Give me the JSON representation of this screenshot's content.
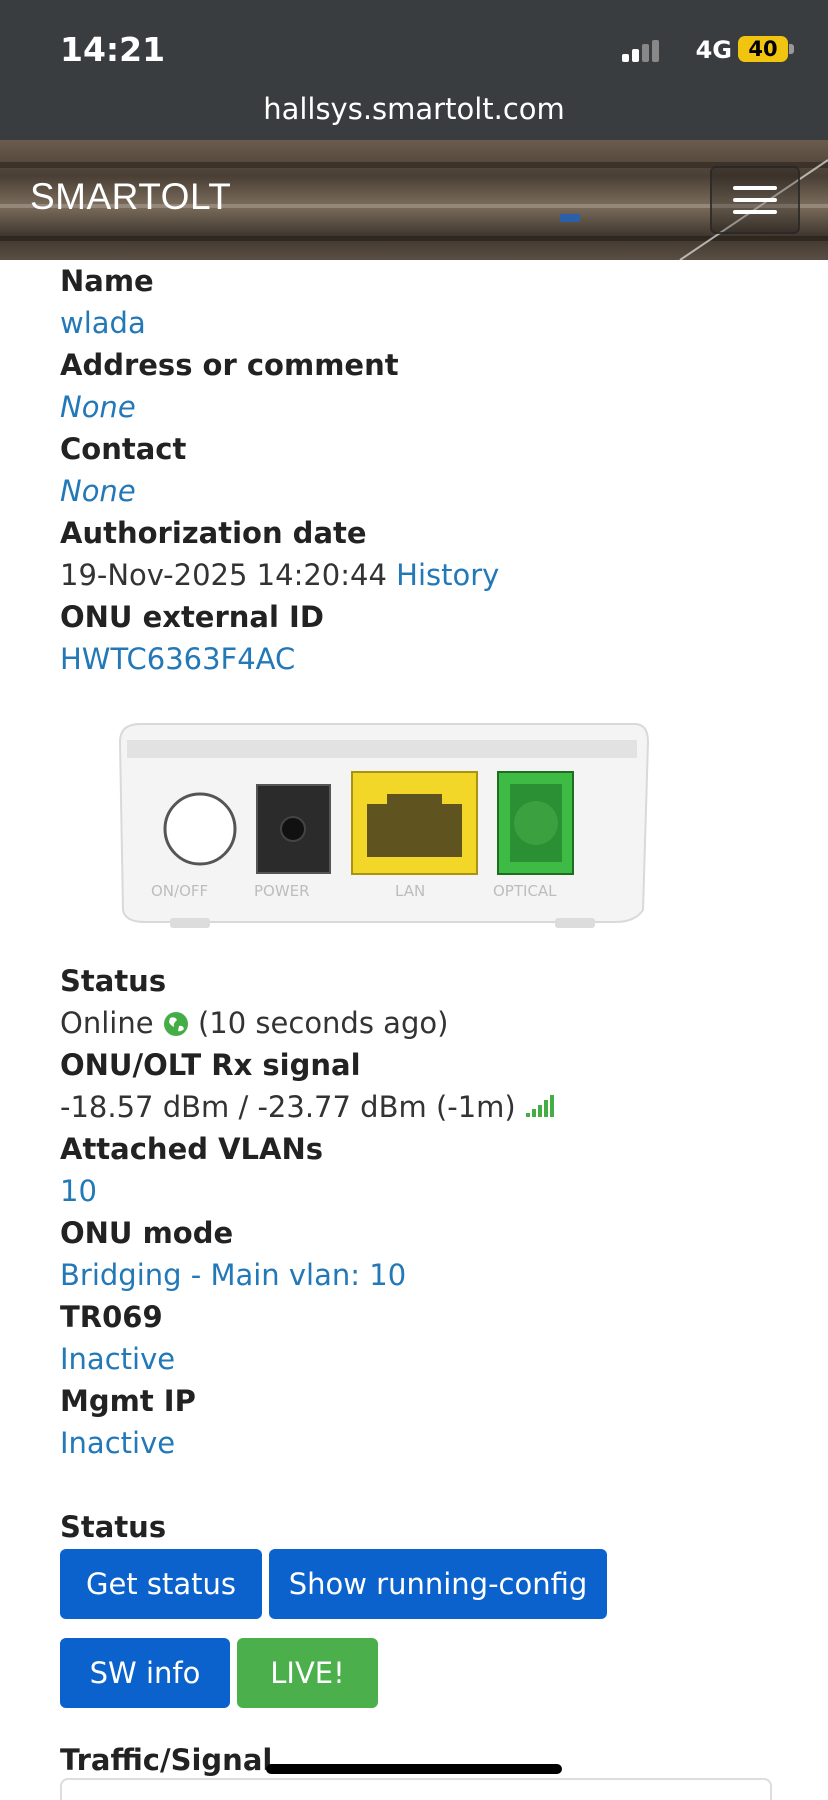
{
  "status_bar": {
    "time": "14:21",
    "network": "4G",
    "battery": "40"
  },
  "browser": {
    "url": "hallsys.smartolt.com"
  },
  "navbar": {
    "brand": "SMARTOLT"
  },
  "details": [
    {
      "label": "Name",
      "value": "wlada"
    },
    {
      "label": "Address or comment",
      "value": "None"
    },
    {
      "label": "Contact",
      "value": "None"
    },
    {
      "label": "Authorization date",
      "value": "19-Nov-2025 14:20:44",
      "link": "History"
    },
    {
      "label": "ONU external ID",
      "value": "HWTC6363F4AC"
    }
  ],
  "device_image": {
    "ports": [
      "ON/OFF",
      "POWER",
      "LAN",
      "OPTICAL"
    ]
  },
  "status_info": [
    {
      "label": "Status",
      "value": "Online",
      "extra": "(10 seconds ago)"
    },
    {
      "label": "ONU/OLT Rx signal",
      "value": "-18.57 dBm / -23.77 dBm (-1m)"
    },
    {
      "label": "Attached VLANs",
      "value": "10"
    },
    {
      "label": "ONU mode",
      "value": "Bridging - Main vlan: 10"
    },
    {
      "label": "TR069",
      "value": "Inactive"
    },
    {
      "label": "Mgmt IP",
      "value": "Inactive"
    }
  ],
  "status_section": {
    "title": "Status",
    "buttons": [
      "Get status",
      "Show running-config",
      "SW info",
      "LIVE!"
    ]
  },
  "traffic_section": {
    "title": "Traffic/Signal"
  },
  "colors": {
    "link": "#2378b8",
    "button_blue": "#0b62cc",
    "button_green": "#4bb04b",
    "online_green": "#45ad45"
  }
}
